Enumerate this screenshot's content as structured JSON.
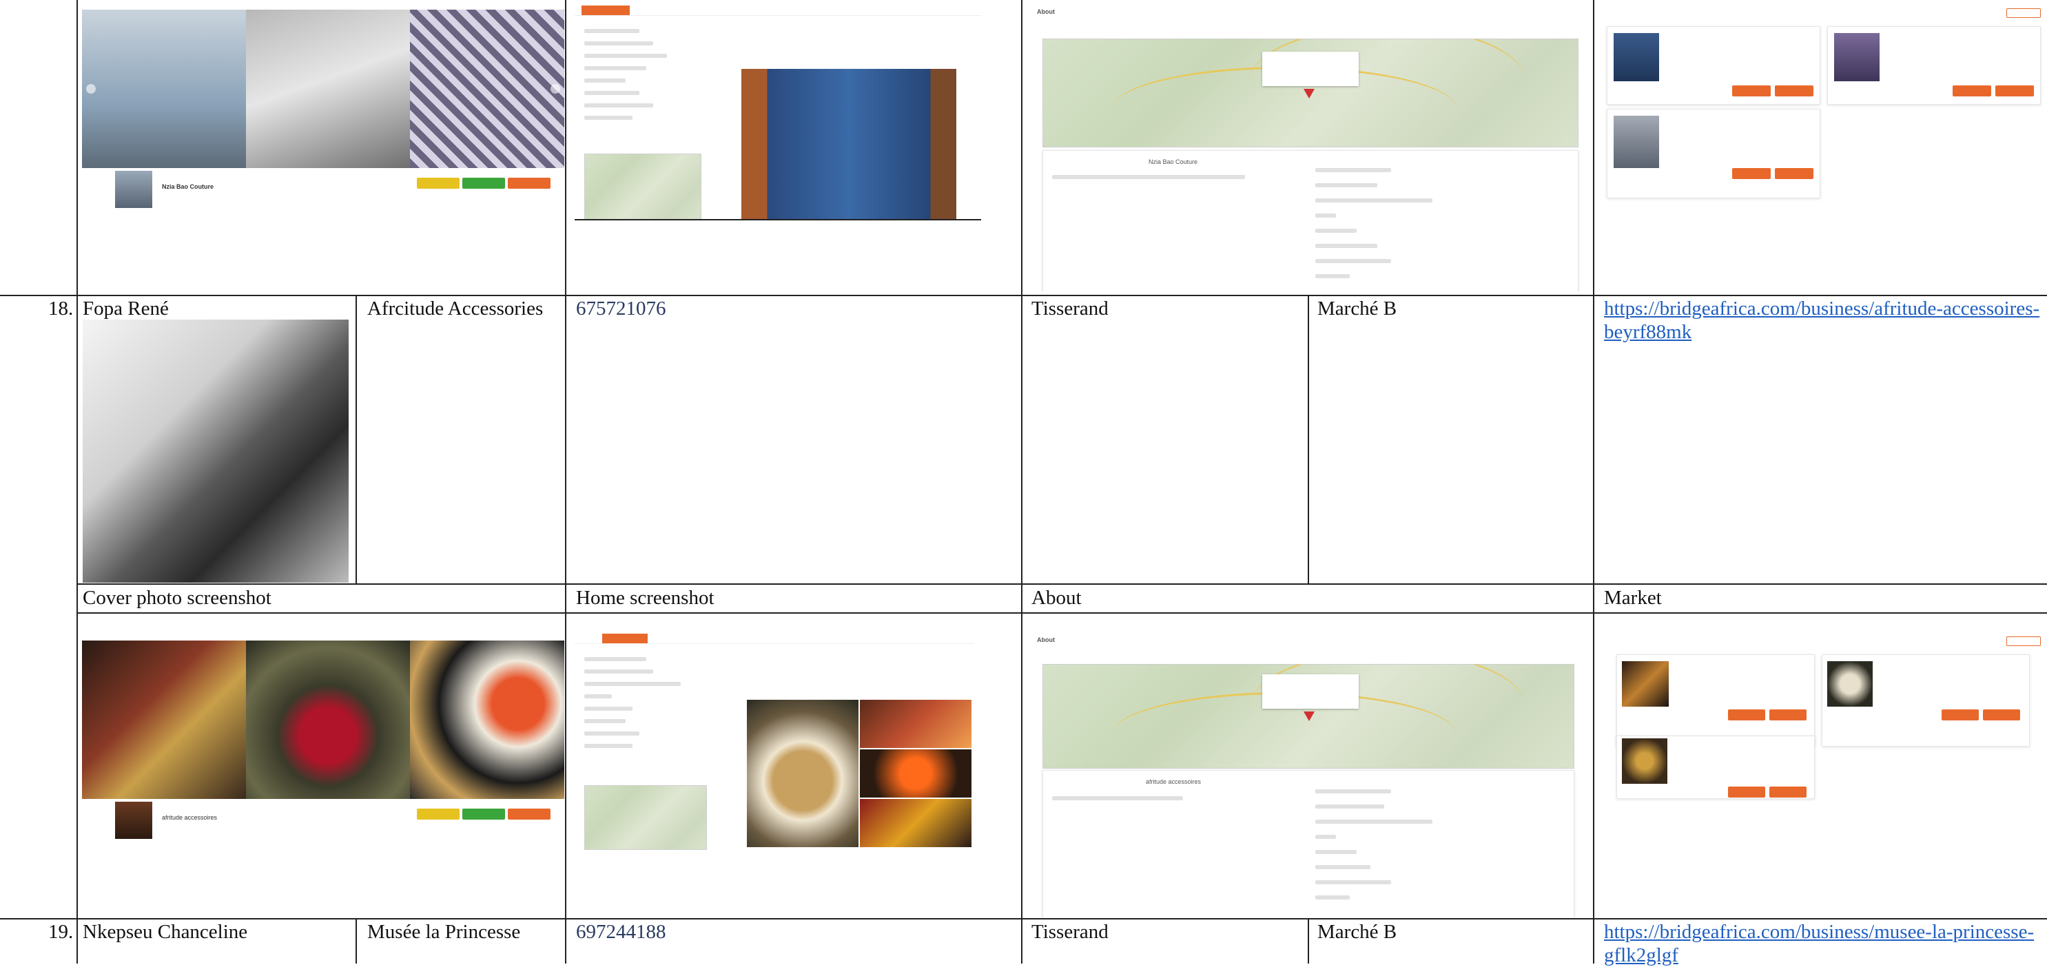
{
  "rows": [
    {
      "number": "18.",
      "name": "Fopa René",
      "business": "Afrcitude Accessories",
      "phone": "675721076",
      "trade": "Tisserand",
      "market": "Marché B",
      "url": "https://bridgeafrica.com/business/afritude-accessoires-beyrf88mk",
      "headers": {
        "cover": "Cover photo screenshot",
        "home": "Home screenshot",
        "about": "About",
        "market": "Market"
      },
      "cover_business_label": "afritude accessoires",
      "about_business_label": "afritude accessoires"
    },
    {
      "number": "19.",
      "name": "Nkepseu Chanceline",
      "business": "Musée la Princesse",
      "phone": "697244188",
      "trade": "Tisserand",
      "market": "Marché B",
      "url": "https://bridgeafrica.com/business/musee-la-princesse-gflk2glgf"
    }
  ],
  "previous_row": {
    "cover_business_label": "Nzia Bao Couture",
    "about_business_label": "Nzia Bao Couture"
  },
  "colors": {
    "accent": "#e8682b",
    "link": "#1f5fc0",
    "phone": "#2a3b60",
    "border": "#222222"
  }
}
